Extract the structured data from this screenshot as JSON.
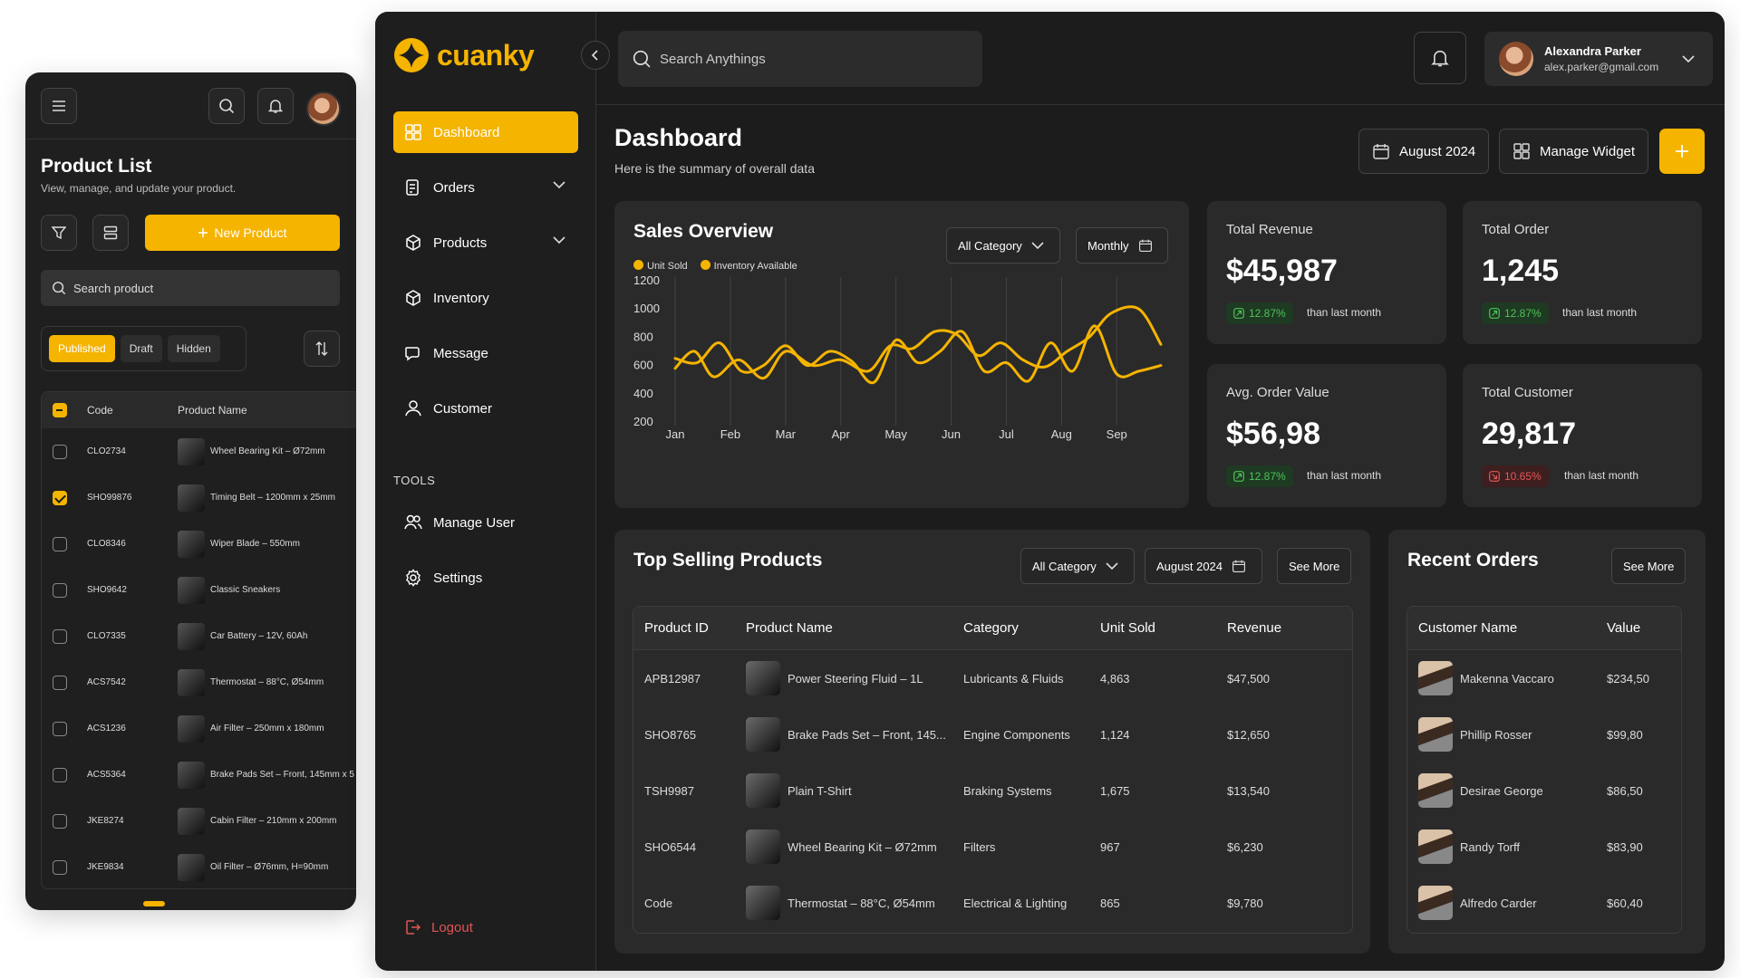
{
  "mobile": {
    "title": "Product List",
    "subtitle": "View, manage, and update your product.",
    "new_product_label": "New Product",
    "search_placeholder": "Search product",
    "tabs": [
      "Published",
      "Draft",
      "Hidden"
    ],
    "columns": [
      "Code",
      "Product Name"
    ],
    "rows": [
      {
        "code": "CLO2734",
        "name": "Wheel Bearing Kit – Ø72mm",
        "checked": false
      },
      {
        "code": "SHO99876",
        "name": "Timing Belt – 1200mm x 25mm",
        "checked": true
      },
      {
        "code": "CLO8346",
        "name": "Wiper Blade – 550mm",
        "checked": false
      },
      {
        "code": "SHO9642",
        "name": "Classic Sneakers",
        "checked": false
      },
      {
        "code": "CLO7335",
        "name": "Car Battery – 12V, 60Ah",
        "checked": false
      },
      {
        "code": "ACS7542",
        "name": "Thermostat – 88°C, Ø54mm",
        "checked": false
      },
      {
        "code": "ACS1236",
        "name": "Air Filter – 250mm x 180mm",
        "checked": false
      },
      {
        "code": "ACS5364",
        "name": "Brake Pads Set – Front, 145mm x 5",
        "checked": false
      },
      {
        "code": "JKE8274",
        "name": "Cabin Filter – 210mm x 200mm",
        "checked": false
      },
      {
        "code": "JKE9834",
        "name": "Oil Filter – Ø76mm, H=90mm",
        "checked": false
      }
    ]
  },
  "brand": {
    "name": "cuanky",
    "accent": "#F5B400"
  },
  "sidebar": {
    "items": [
      {
        "label": "Dashboard",
        "icon": "grid-icon"
      },
      {
        "label": "Orders",
        "icon": "orders-icon"
      },
      {
        "label": "Products",
        "icon": "box-icon"
      },
      {
        "label": "Inventory",
        "icon": "cube-icon"
      },
      {
        "label": "Message",
        "icon": "chat-icon"
      },
      {
        "label": "Customer",
        "icon": "user-icon"
      }
    ],
    "tools_label": "TOOLS",
    "tools": [
      {
        "label": "Manage User",
        "icon": "users-icon"
      },
      {
        "label": "Settings",
        "icon": "gear-icon"
      }
    ],
    "logout_label": "Logout"
  },
  "header": {
    "search_placeholder": "Search Anythings",
    "user": {
      "name": "Alexandra Parker",
      "email": "alex.parker@gmail.com"
    }
  },
  "page": {
    "title": "Dashboard",
    "subtitle": "Here is the summary of overall data",
    "date_label": "August 2024",
    "manage_widget_label": "Manage Widget"
  },
  "sales": {
    "title": "Sales Overview",
    "category_label": "All Category",
    "period_label": "Monthly",
    "legend": [
      "Unit Sold",
      "Inventory Available"
    ]
  },
  "chart_data": {
    "type": "line",
    "title": "Sales Overview",
    "categories": [
      "Jan",
      "Feb",
      "Mar",
      "Apr",
      "May",
      "Jun",
      "Jul",
      "Aug",
      "Sep"
    ],
    "y_ticks": [
      1200,
      1000,
      800,
      600,
      400,
      200
    ],
    "ylim": [
      200,
      1200
    ],
    "grid": "vertical",
    "legend_position": "top-left",
    "series": [
      {
        "name": "Unit Sold",
        "color": "#F5B400",
        "x": [
          0.0,
          0.35,
          0.7,
          1.15,
          1.6,
          2.0,
          2.5,
          3.0,
          3.5,
          3.9,
          4.3,
          4.7,
          5.1,
          5.5,
          5.9,
          6.3,
          6.7,
          7.1,
          7.5,
          7.9,
          8.4,
          8.8
        ],
        "values": [
          580,
          700,
          520,
          640,
          510,
          700,
          600,
          640,
          560,
          740,
          720,
          840,
          820,
          670,
          760,
          640,
          590,
          700,
          800,
          970,
          1000,
          750
        ]
      },
      {
        "name": "Inventory Available",
        "color": "#F5B400",
        "x": [
          0.0,
          0.4,
          0.8,
          1.2,
          1.6,
          2.0,
          2.4,
          2.8,
          3.2,
          3.6,
          4.0,
          4.4,
          4.8,
          5.2,
          5.6,
          6.0,
          6.4,
          6.8,
          7.2,
          7.6,
          8.0,
          8.4,
          8.8
        ],
        "values": [
          650,
          620,
          760,
          560,
          600,
          740,
          600,
          700,
          630,
          480,
          780,
          620,
          700,
          840,
          560,
          620,
          490,
          760,
          560,
          880,
          540,
          560,
          600
        ]
      }
    ]
  },
  "stats": [
    {
      "label": "Total Revenue",
      "value": "$45,987",
      "change": "12.87%",
      "trend": "up",
      "note": "than last month"
    },
    {
      "label": "Total Order",
      "value": "1,245",
      "change": "12.87%",
      "trend": "up",
      "note": "than last month"
    },
    {
      "label": "Avg. Order Value",
      "value": "$56,98",
      "change": "12.87%",
      "trend": "up",
      "note": "than last month"
    },
    {
      "label": "Total Customer",
      "value": "29,817",
      "change": "10.65%",
      "trend": "down",
      "note": "than last month"
    }
  ],
  "top_selling": {
    "title": "Top Selling Products",
    "category_label": "All Category",
    "date_label": "August 2024",
    "see_more": "See More",
    "columns": [
      "Product ID",
      "Product Name",
      "Category",
      "Unit Sold",
      "Revenue"
    ],
    "rows": [
      {
        "id": "APB12987",
        "name": "Power Steering Fluid – 1L",
        "category": "Lubricants & Fluids",
        "units": "4,863",
        "revenue": "$47,500"
      },
      {
        "id": "SHO8765",
        "name": "Brake Pads Set – Front, 145...",
        "category": "Engine Components",
        "units": "1,124",
        "revenue": "$12,650"
      },
      {
        "id": "TSH9987",
        "name": "Plain T-Shirt",
        "category": "Braking Systems",
        "units": "1,675",
        "revenue": "$13,540"
      },
      {
        "id": "SHO6544",
        "name": "Wheel Bearing Kit – Ø72mm",
        "category": "Filters",
        "units": "967",
        "revenue": "$6,230"
      },
      {
        "id": "Code",
        "name": "Thermostat – 88°C, Ø54mm",
        "category": "Electrical & Lighting",
        "units": "865",
        "revenue": "$9,780"
      }
    ]
  },
  "recent_orders": {
    "title": "Recent Orders",
    "see_more": "See More",
    "columns": [
      "Customer Name",
      "Value"
    ],
    "rows": [
      {
        "name": "Makenna Vaccaro",
        "value": "$234,50"
      },
      {
        "name": "Phillip Rosser",
        "value": "$99,80"
      },
      {
        "name": "Desirae George",
        "value": "$86,50"
      },
      {
        "name": "Randy Torff",
        "value": "$83,90"
      },
      {
        "name": "Alfredo Carder",
        "value": "$60,40"
      }
    ]
  }
}
